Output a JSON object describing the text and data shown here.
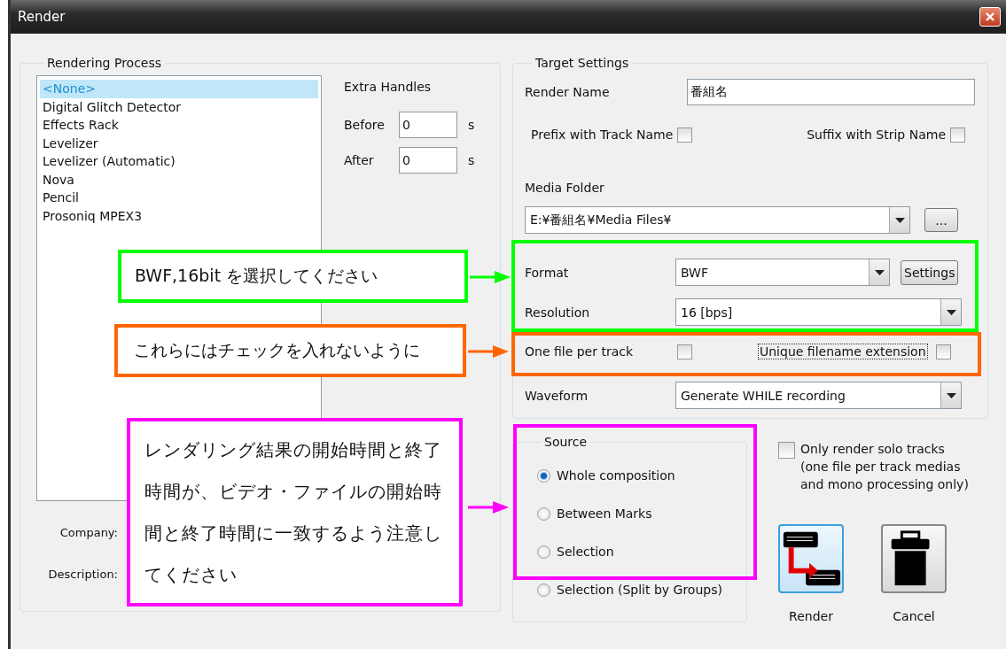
{
  "window": {
    "title": "Render"
  },
  "rendering_process": {
    "title": "Rendering Process",
    "items": [
      {
        "label": "<None>",
        "selected": true
      },
      {
        "label": "Digital Glitch Detector",
        "selected": false
      },
      {
        "label": "Effects Rack",
        "selected": false
      },
      {
        "label": "Levelizer",
        "selected": false
      },
      {
        "label": "Levelizer (Automatic)",
        "selected": false
      },
      {
        "label": "Nova",
        "selected": false
      },
      {
        "label": "Pencil",
        "selected": false
      },
      {
        "label": "Prosoniq MPEX3",
        "selected": false
      }
    ],
    "extra_handles": {
      "title": "Extra Handles",
      "fields": [
        {
          "label": "Before",
          "value": "0",
          "unit": "s"
        },
        {
          "label": "After",
          "value": "0",
          "unit": "s"
        }
      ]
    },
    "company": {
      "label": "Company:"
    },
    "description": {
      "label": "Description:"
    }
  },
  "target_settings": {
    "title": "Target Settings",
    "render_name": {
      "label": "Render Name",
      "value": "番組名"
    },
    "prefix_with_track_name": {
      "label": "Prefix with Track Name",
      "checked": false
    },
    "suffix_with_strip_name": {
      "label": "Suffix with Strip Name",
      "checked": false
    },
    "media_folder": {
      "label": "Media Folder",
      "value": "E:¥番組名¥Media Files¥",
      "browse_button": "..."
    },
    "format": {
      "label": "Format",
      "value": "BWF",
      "settings_button": "Settings"
    },
    "resolution": {
      "label": "Resolution",
      "value": "16 [bps]"
    },
    "one_file_per_track": {
      "label": "One file per track",
      "checked": false
    },
    "unique_filename_extension": {
      "label": "Unique filename extension",
      "checked": false,
      "focused": true
    },
    "waveform": {
      "label": "Waveform",
      "value": "Generate WHILE recording"
    }
  },
  "source": {
    "title": "Source",
    "options": [
      {
        "label": "Whole composition",
        "selected": true
      },
      {
        "label": "Between Marks",
        "selected": false
      },
      {
        "label": "Selection",
        "selected": false
      },
      {
        "label": "Selection (Split by Groups)",
        "selected": false
      }
    ]
  },
  "only_render_solo_tracks": {
    "label": "Only render solo tracks\n(one file per track medias\nand mono processing only)",
    "checked": false
  },
  "actions": [
    {
      "kind": "render",
      "label": "Render"
    },
    {
      "kind": "cancel",
      "label": "Cancel"
    }
  ],
  "callouts": [
    {
      "text": "BWF,16bit を選択してください",
      "color": "#00ff00"
    },
    {
      "text": "これらにはチェックを入れないように",
      "color": "#ff6600"
    },
    {
      "text": "レンダリング結果の開始時間と終了時間が、ビデオ・ファイルの開始時間と終了時間に一致するよう注意してください",
      "color": "#ff00ff"
    }
  ]
}
